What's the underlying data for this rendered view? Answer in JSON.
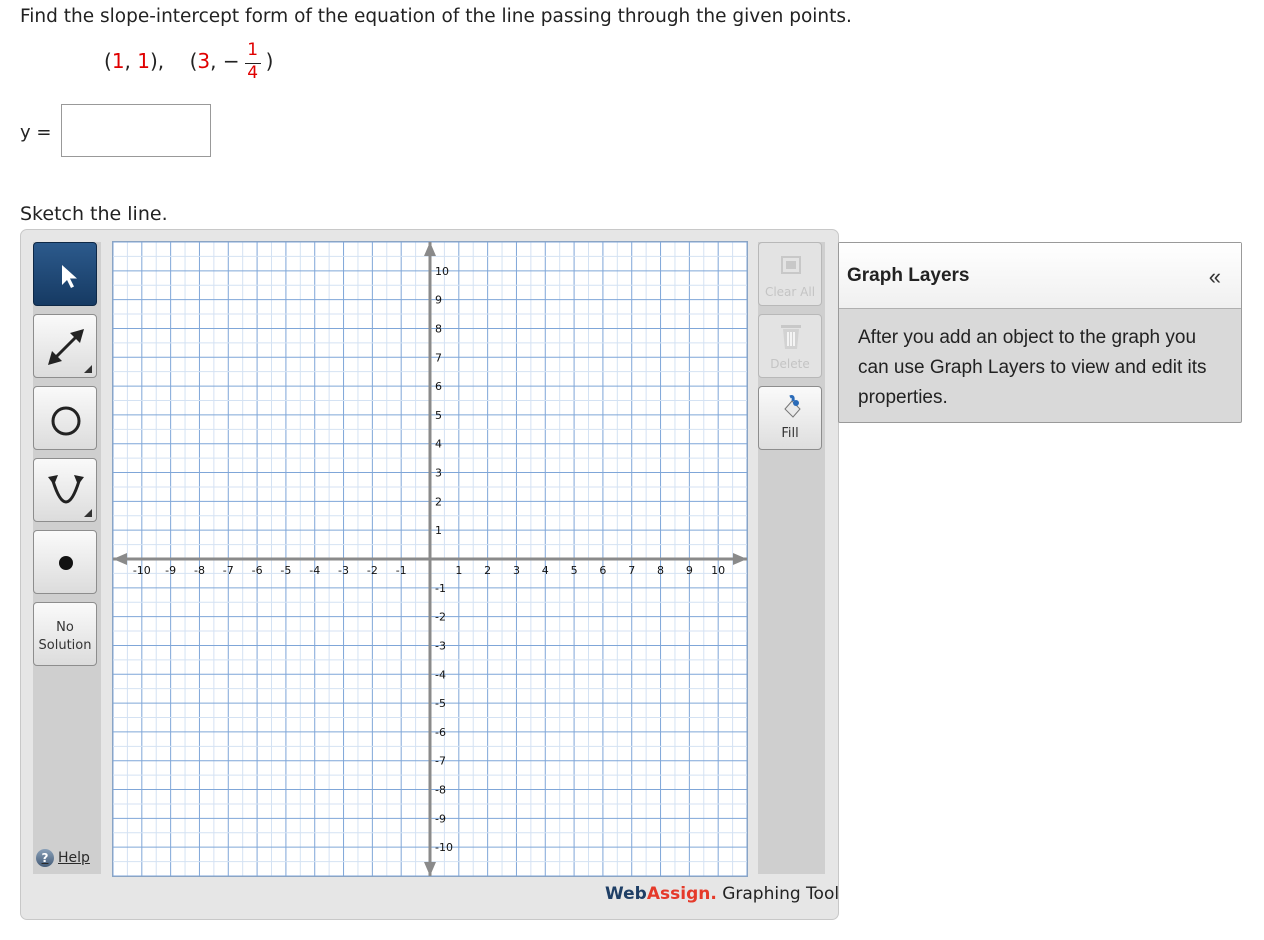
{
  "question": {
    "prompt": "Find the slope-intercept form of the equation of the line passing through the given points.",
    "p1_open": "(",
    "p1_x": "1",
    "p1_sep": ", ",
    "p1_y": "1",
    "p1_close": "),",
    "p2_open": "(",
    "p2_x": "3",
    "p2_sep": ", −",
    "p2_num": "1",
    "p2_den": "4",
    "p2_close": ")"
  },
  "answer": {
    "label": "y =",
    "value": ""
  },
  "sketch_label": "Sketch the line.",
  "toolbar": {
    "no_solution_line1": "No",
    "no_solution_line2": "Solution",
    "help": "Help"
  },
  "right_tools": {
    "clear_all": "Clear All",
    "delete": "Delete",
    "fill": "Fill"
  },
  "graph": {
    "x_ticks": [
      "-10",
      "-9",
      "-8",
      "-7",
      "-6",
      "-5",
      "-4",
      "-3",
      "-2",
      "-1",
      "1",
      "2",
      "3",
      "4",
      "5",
      "6",
      "7",
      "8",
      "9",
      "10"
    ],
    "y_ticks": [
      "10",
      "9",
      "8",
      "7",
      "6",
      "5",
      "4",
      "3",
      "2",
      "1",
      "-1",
      "-2",
      "-3",
      "-4",
      "-5",
      "-6",
      "-7",
      "-8",
      "-9",
      "-10"
    ],
    "xlim": [
      -11,
      11
    ],
    "ylim": [
      -11,
      11
    ]
  },
  "brand": {
    "web": "Web",
    "assign": "Assign.",
    "rest": " Graphing Tool"
  },
  "layers": {
    "title": "Graph Layers",
    "collapse": "«",
    "body": "After you add an object to the graph you can use Graph Layers to view and edit its properties."
  }
}
